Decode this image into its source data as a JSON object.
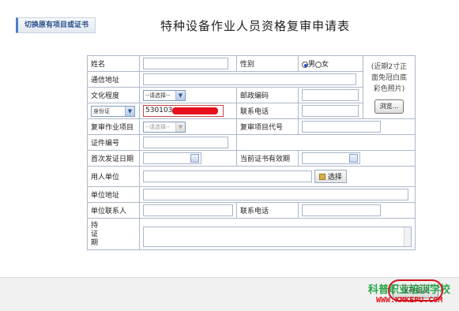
{
  "switch_tab_label": "切换原有项目或证书",
  "page_title": "特种设备作业人员资格复审申请表",
  "labels": {
    "name": "姓名",
    "gender": "性别",
    "address": "通信地址",
    "education": "文化程度",
    "postcode": "邮政编码",
    "phone": "联系电话",
    "review_item": "复审作业项目",
    "review_code": "复审项目代号",
    "cert_no": "证件编号",
    "first_issue": "首次发证日期",
    "cert_valid": "当前证书有效期",
    "employer": "用人单位",
    "unit_address": "单位地址",
    "unit_contact": "单位联系人",
    "unit_phone": "联系电话",
    "hold_cert": "持证期"
  },
  "gender_options": {
    "male": "男",
    "female": "女"
  },
  "photo_note": "(近期2寸正面免冠白底彩色照片)",
  "browse_button": "浏览...",
  "education_select": "--请选择--",
  "id_type_select": "身份证",
  "id_number_value": "530103",
  "review_item_select": "--请选择--",
  "choose_button": "选择",
  "save_button": "保存提交",
  "watermark_cn": "科普职业培训学校",
  "watermark_url": "WWW.KMKEPU.COM"
}
